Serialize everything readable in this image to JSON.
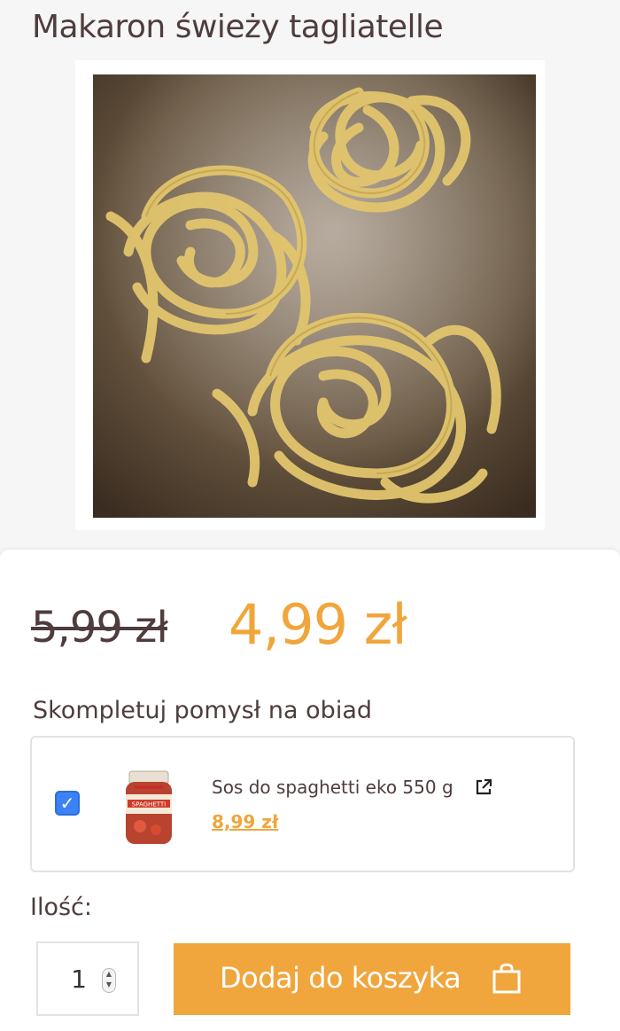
{
  "product": {
    "title": "Makaron świeży tagliatelle",
    "old_price": "5,99 zł",
    "new_price": "4,99 zł"
  },
  "complement": {
    "heading": "Skompletuj pomysł na obiad",
    "addon": {
      "name": "Sos do spaghetti eko 550 g",
      "price": "8,99 zł",
      "checked": true,
      "jar_label": "SPAGHETTI"
    }
  },
  "quantity": {
    "label": "Ilość:",
    "value": "1"
  },
  "cart": {
    "button_label": "Dodaj do koszyka"
  },
  "colors": {
    "accent": "#f0a63c",
    "text": "#4f3c3c",
    "checkbox": "#3b82f6"
  }
}
